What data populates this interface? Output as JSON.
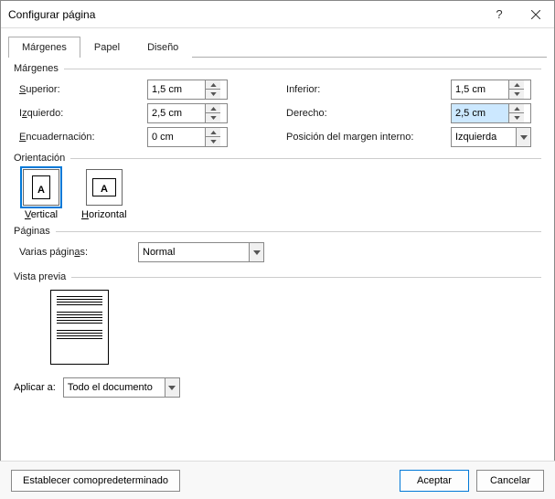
{
  "window": {
    "title": "Configurar página"
  },
  "tabs": {
    "margins": "Márgenes",
    "paper": "Papel",
    "design": "Diseño"
  },
  "margins": {
    "group": "Márgenes",
    "top_label": "Superior:",
    "top_value": "1,5 cm",
    "left_label": "Izquierdo:",
    "left_value": "2,5 cm",
    "gutter_label": "Encuadernación:",
    "gutter_value": "0 cm",
    "bottom_label": "Inferior:",
    "bottom_value": "1,5 cm",
    "right_label": "Derecho:",
    "right_value": "2,5 cm",
    "gutterpos_label": "Posición del margen interno:",
    "gutterpos_value": "Izquierda"
  },
  "orientation": {
    "group": "Orientación",
    "vertical": "Vertical",
    "horizontal": "Horizontal"
  },
  "pages": {
    "group": "Páginas",
    "multi_label": "Varias páginas:",
    "multi_value": "Normal"
  },
  "preview": {
    "group": "Vista previa"
  },
  "apply": {
    "label": "Aplicar a:",
    "value": "Todo el documento"
  },
  "footer": {
    "default": "Establecer como predeterminado",
    "ok": "Aceptar",
    "cancel": "Cancelar"
  }
}
